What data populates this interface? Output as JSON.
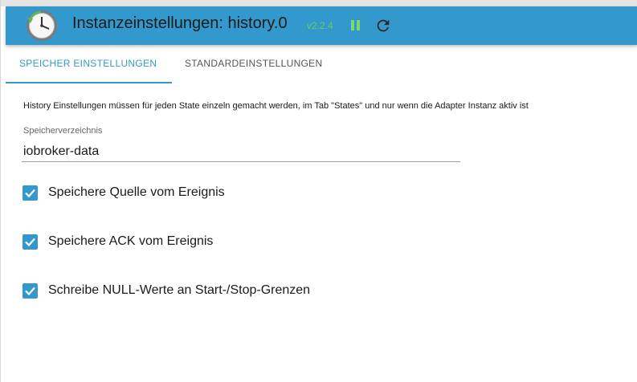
{
  "header": {
    "title": "Instanzeinstellungen: history.0",
    "version": "v2.2.4",
    "logo_icon": "clock-history-icon",
    "pause_icon": "pause-icon",
    "reload_icon": "reload-icon",
    "background_color": "#3399cc"
  },
  "tabs": [
    {
      "label": "SPEICHER EINSTELLUNGEN",
      "active": true
    },
    {
      "label": "STANDARDEINSTELLUNGEN",
      "active": false
    }
  ],
  "content": {
    "info_text": "History Einstellungen müssen für jeden State einzeln gemacht werden, im Tab \"States\" und nur wenn die Adapter Instanz aktiv ist",
    "storage_dir": {
      "label": "Speicherverzeichnis",
      "value": "iobroker-data"
    },
    "checkboxes": [
      {
        "label": "Speichere Quelle vom Ereignis",
        "checked": true
      },
      {
        "label": "Speichere ACK vom Ereignis",
        "checked": true
      },
      {
        "label": "Schreibe NULL-Werte an Start-/Stop-Grenzen",
        "checked": true
      }
    ]
  },
  "colors": {
    "accent": "#3399cc",
    "version": "#66cc66",
    "pause": "#7fd86b"
  }
}
